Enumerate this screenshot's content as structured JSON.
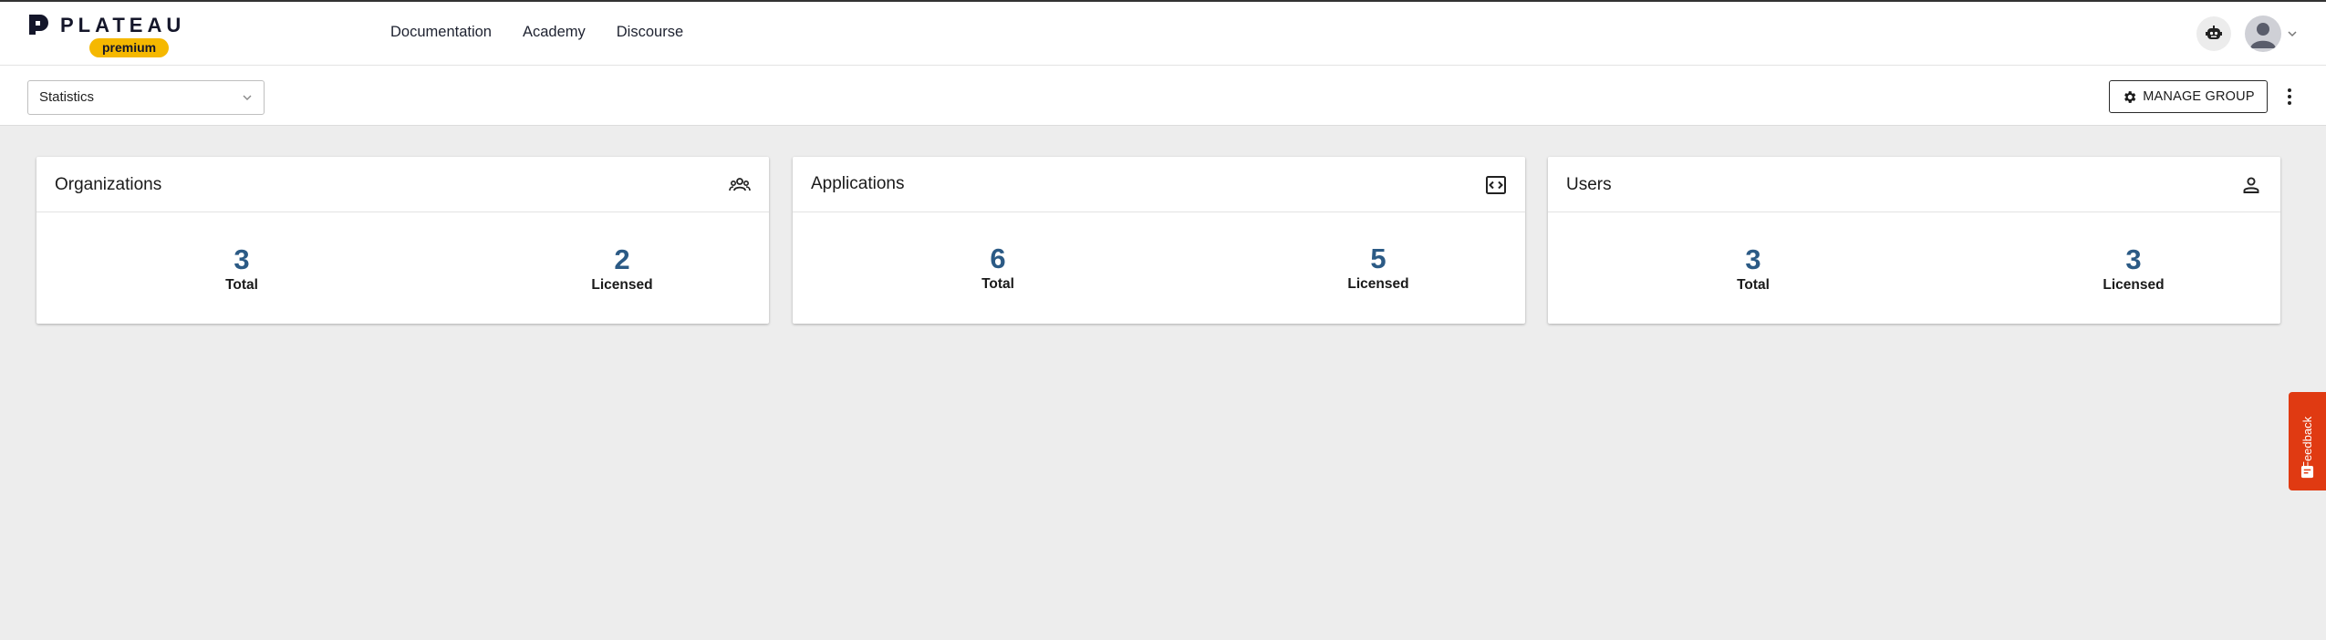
{
  "brand": {
    "name": "PLATEAU",
    "badge": "premium",
    "colors": {
      "badge": "#f5b800",
      "ink": "#14162a"
    }
  },
  "nav": {
    "items": [
      {
        "label": "Documentation"
      },
      {
        "label": "Academy"
      },
      {
        "label": "Discourse"
      }
    ]
  },
  "header": {
    "bot_icon": "robot-icon",
    "avatar_icon": "user-avatar-icon"
  },
  "toolbar": {
    "select": {
      "value": "Statistics"
    },
    "manage_group_label": "MANAGE GROUP",
    "manage_group_icon": "gear-icon",
    "more_icon": "kebab-menu-icon"
  },
  "cards": [
    {
      "title": "Organizations",
      "icon": "group-icon",
      "stats": [
        {
          "value": "3",
          "label": "Total"
        },
        {
          "value": "2",
          "label": "Licensed"
        }
      ]
    },
    {
      "title": "Applications",
      "icon": "code-window-icon",
      "stats": [
        {
          "value": "6",
          "label": "Total"
        },
        {
          "value": "5",
          "label": "Licensed"
        }
      ]
    },
    {
      "title": "Users",
      "icon": "person-icon",
      "stats": [
        {
          "value": "3",
          "label": "Total"
        },
        {
          "value": "3",
          "label": "Licensed"
        }
      ]
    }
  ],
  "feedback": {
    "label": "Feedback",
    "color": "#e03a12"
  },
  "colors": {
    "stat_number": "#2b5a85",
    "background": "#ededed"
  }
}
